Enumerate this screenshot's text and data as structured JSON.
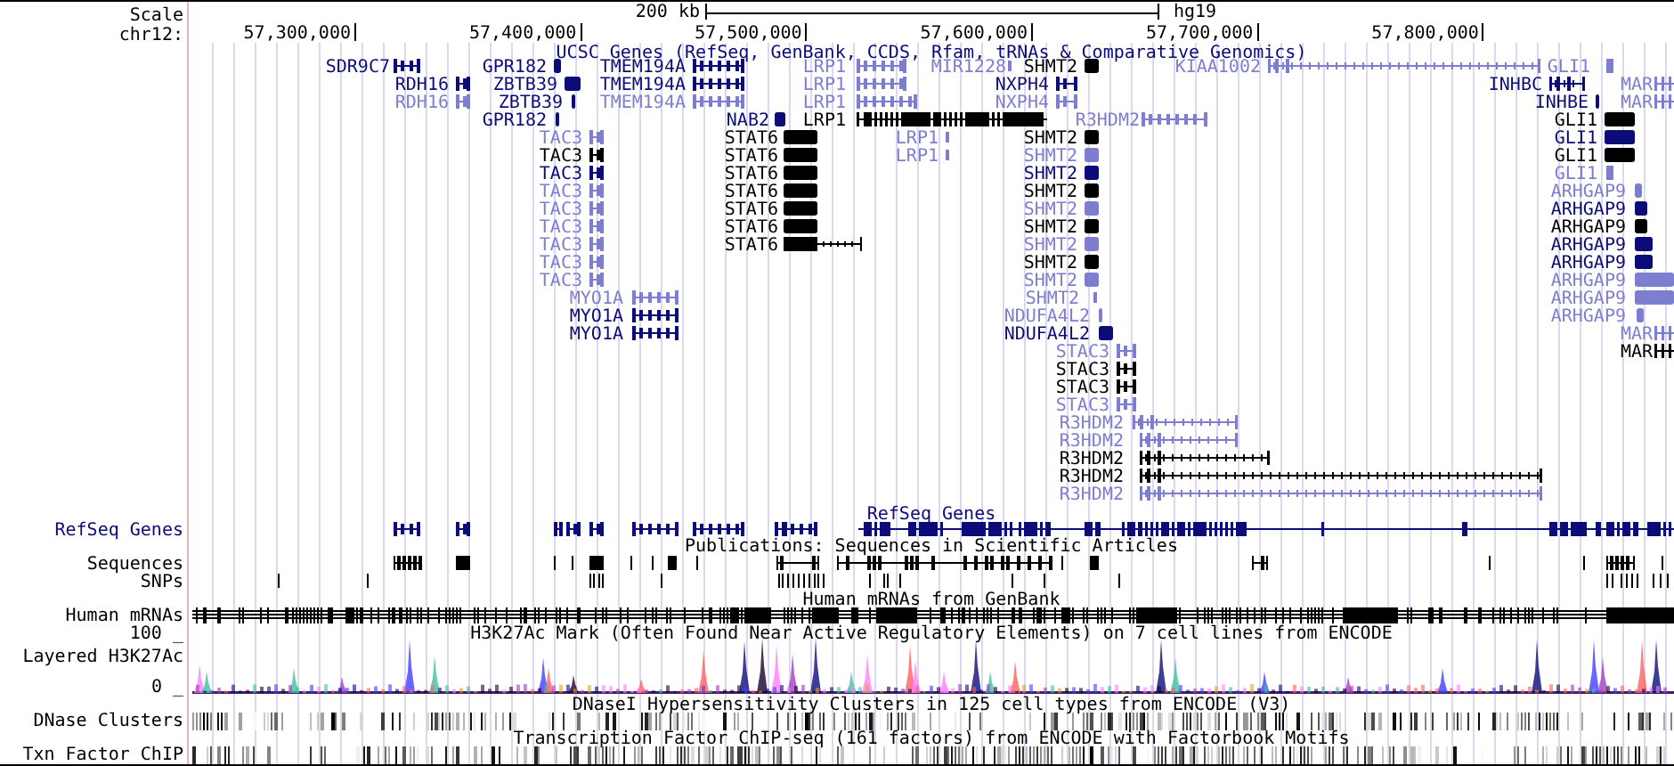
{
  "scale": {
    "label": "Scale",
    "size": "200 kb",
    "assembly": "hg19"
  },
  "ruler": {
    "chrom": "chr12:",
    "ticks": [
      "57,300,000",
      "57,400,000",
      "57,500,000",
      "57,600,000",
      "57,700,000",
      "57,800,000"
    ]
  },
  "gene_track": {
    "title": "UCSC Genes (RefSeq, GenBank, CCDS, Rfam, tRNAs & Comparative Genomics)",
    "rows": [
      {
        "genes": [
          {
            "label": "SDR9C7",
            "color": "#0c0c78"
          },
          {
            "label": "GPR182",
            "color": "#0c0c78"
          },
          {
            "label": "TMEM194A",
            "color": "#0c0c78"
          },
          {
            "label": "LRP1",
            "color": "#7e7ed0"
          },
          {
            "label": "MIR1228",
            "color": "#7e7ed0"
          },
          {
            "label": "SHMT2",
            "color": "#000000"
          },
          {
            "label": "KIAA1002",
            "color": "#7e7ed0"
          },
          {
            "label": "GLI1",
            "color": "#7e7ed0"
          }
        ]
      },
      {
        "genes": [
          {
            "label": "RDH16",
            "color": "#0c0c78"
          },
          {
            "label": "ZBTB39",
            "color": "#0c0c78"
          },
          {
            "label": "TMEM194A",
            "color": "#0c0c78"
          },
          {
            "label": "LRP1",
            "color": "#7e7ed0"
          },
          {
            "label": "NXPH4",
            "color": "#0c0c78"
          },
          {
            "label": "INHBC",
            "color": "#0c0c78"
          },
          {
            "label": "MAR",
            "color": "#7e7ed0"
          }
        ]
      },
      {
        "genes": [
          {
            "label": "RDH16",
            "color": "#7e7ed0"
          },
          {
            "label": "ZBTB39",
            "color": "#0c0c78"
          },
          {
            "label": "TMEM194A",
            "color": "#7e7ed0"
          },
          {
            "label": "LRP1",
            "color": "#7e7ed0"
          },
          {
            "label": "NXPH4",
            "color": "#7e7ed0"
          },
          {
            "label": "INHBE",
            "color": "#0c0c78"
          },
          {
            "label": "MAR",
            "color": "#7e7ed0"
          }
        ]
      },
      {
        "genes": [
          {
            "label": "GPR182",
            "color": "#0c0c78"
          },
          {
            "label": "NAB2",
            "color": "#0c0c78"
          },
          {
            "label": "LRP1",
            "color": "#000000"
          },
          {
            "label": "R3HDM2",
            "color": "#7e7ed0"
          },
          {
            "label": "GLI1",
            "color": "#000000"
          }
        ]
      },
      {
        "genes": [
          {
            "label": "TAC3",
            "color": "#7e7ed0"
          },
          {
            "label": "STAT6",
            "color": "#000000"
          },
          {
            "label": "LRP1",
            "color": "#7e7ed0"
          },
          {
            "label": "SHMT2",
            "color": "#000000"
          },
          {
            "label": "GLI1",
            "color": "#0c0c78"
          }
        ]
      },
      {
        "genes": [
          {
            "label": "TAC3",
            "color": "#000000"
          },
          {
            "label": "STAT6",
            "color": "#000000"
          },
          {
            "label": "LRP1",
            "color": "#7e7ed0"
          },
          {
            "label": "SHMT2",
            "color": "#7e7ed0"
          },
          {
            "label": "GLI1",
            "color": "#000000"
          }
        ]
      },
      {
        "genes": [
          {
            "label": "TAC3",
            "color": "#0c0c78"
          },
          {
            "label": "STAT6",
            "color": "#000000"
          },
          {
            "label": "SHMT2",
            "color": "#0c0c78"
          },
          {
            "label": "GLI1",
            "color": "#7e7ed0"
          }
        ]
      },
      {
        "genes": [
          {
            "label": "TAC3",
            "color": "#7e7ed0"
          },
          {
            "label": "STAT6",
            "color": "#000000"
          },
          {
            "label": "SHMT2",
            "color": "#000000"
          },
          {
            "label": "ARHGAP9",
            "color": "#7e7ed0"
          }
        ]
      },
      {
        "genes": [
          {
            "label": "TAC3",
            "color": "#7e7ed0"
          },
          {
            "label": "STAT6",
            "color": "#000000"
          },
          {
            "label": "SHMT2",
            "color": "#7e7ed0"
          },
          {
            "label": "ARHGAP9",
            "color": "#0c0c78"
          }
        ]
      },
      {
        "genes": [
          {
            "label": "TAC3",
            "color": "#7e7ed0"
          },
          {
            "label": "STAT6",
            "color": "#000000"
          },
          {
            "label": "SHMT2",
            "color": "#000000"
          },
          {
            "label": "ARHGAP9",
            "color": "#000000"
          }
        ]
      },
      {
        "genes": [
          {
            "label": "TAC3",
            "color": "#7e7ed0"
          },
          {
            "label": "STAT6",
            "color": "#000000"
          },
          {
            "label": "SHMT2",
            "color": "#7e7ed0"
          },
          {
            "label": "ARHGAP9",
            "color": "#0c0c78"
          }
        ]
      },
      {
        "genes": [
          {
            "label": "TAC3",
            "color": "#7e7ed0"
          },
          {
            "label": "SHMT2",
            "color": "#000000"
          },
          {
            "label": "ARHGAP9",
            "color": "#0c0c78"
          }
        ]
      },
      {
        "genes": [
          {
            "label": "TAC3",
            "color": "#7e7ed0"
          },
          {
            "label": "SHMT2",
            "color": "#7e7ed0"
          },
          {
            "label": "ARHGAP9",
            "color": "#7e7ed0"
          }
        ]
      },
      {
        "genes": [
          {
            "label": "MYO1A",
            "color": "#7e7ed0"
          },
          {
            "label": "SHMT2",
            "color": "#7e7ed0"
          },
          {
            "label": "ARHGAP9",
            "color": "#7e7ed0"
          }
        ]
      },
      {
        "genes": [
          {
            "label": "MYO1A",
            "color": "#0c0c78"
          },
          {
            "label": "NDUFA4L2",
            "color": "#7e7ed0"
          },
          {
            "label": "ARHGAP9",
            "color": "#7e7ed0"
          }
        ]
      },
      {
        "genes": [
          {
            "label": "MYO1A",
            "color": "#0c0c78"
          },
          {
            "label": "NDUFA4L2",
            "color": "#0c0c78"
          },
          {
            "label": "MAR",
            "color": "#7e7ed0"
          }
        ]
      },
      {
        "genes": [
          {
            "label": "STAC3",
            "color": "#7e7ed0"
          },
          {
            "label": "MAR",
            "color": "#000000"
          }
        ]
      },
      {
        "genes": [
          {
            "label": "STAC3",
            "color": "#000000"
          }
        ]
      },
      {
        "genes": [
          {
            "label": "STAC3",
            "color": "#000000"
          }
        ]
      },
      {
        "genes": [
          {
            "label": "STAC3",
            "color": "#7e7ed0"
          }
        ]
      },
      {
        "genes": [
          {
            "label": "R3HDM2",
            "color": "#7e7ed0"
          }
        ]
      },
      {
        "genes": [
          {
            "label": "R3HDM2",
            "color": "#7e7ed0"
          }
        ]
      },
      {
        "genes": [
          {
            "label": "R3HDM2",
            "color": "#000000"
          }
        ]
      },
      {
        "genes": [
          {
            "label": "R3HDM2",
            "color": "#000000"
          }
        ]
      },
      {
        "genes": [
          {
            "label": "R3HDM2",
            "color": "#7e7ed0"
          }
        ]
      }
    ]
  },
  "tracks": [
    {
      "kind": "genes",
      "label": "RefSeq Genes",
      "title": "RefSeq Genes",
      "color": "#0c0c78"
    },
    {
      "kind": "publications",
      "label": "Sequences",
      "title": "Publications: Sequences in Scientific Articles",
      "color": "#000000"
    },
    {
      "kind": "snps",
      "label": "SNPs",
      "color": "#000000"
    },
    {
      "kind": "mrnas",
      "label": "Human mRNAs",
      "title": "Human mRNAs from GenBank",
      "color": "#000000"
    },
    {
      "kind": "signal",
      "label": "Layered H3K27Ac",
      "title": "H3K27Ac Mark (Often Found Near Active Regulatory Elements) on 7 cell lines from ENCODE",
      "max_label": "100 _",
      "min_label": "0 _",
      "color": "#000000"
    },
    {
      "kind": "density",
      "label": "DNase Clusters",
      "title": "DNaseI Hypersensitivity Clusters in 125 cell types from ENCODE (V3)",
      "color": "#000000"
    },
    {
      "kind": "density",
      "label": "Txn Factor ChIP",
      "title": "Transcription Factor ChIP-seq (161 factors) from ENCODE with Factorbook Motifs",
      "color": "#000000"
    }
  ]
}
